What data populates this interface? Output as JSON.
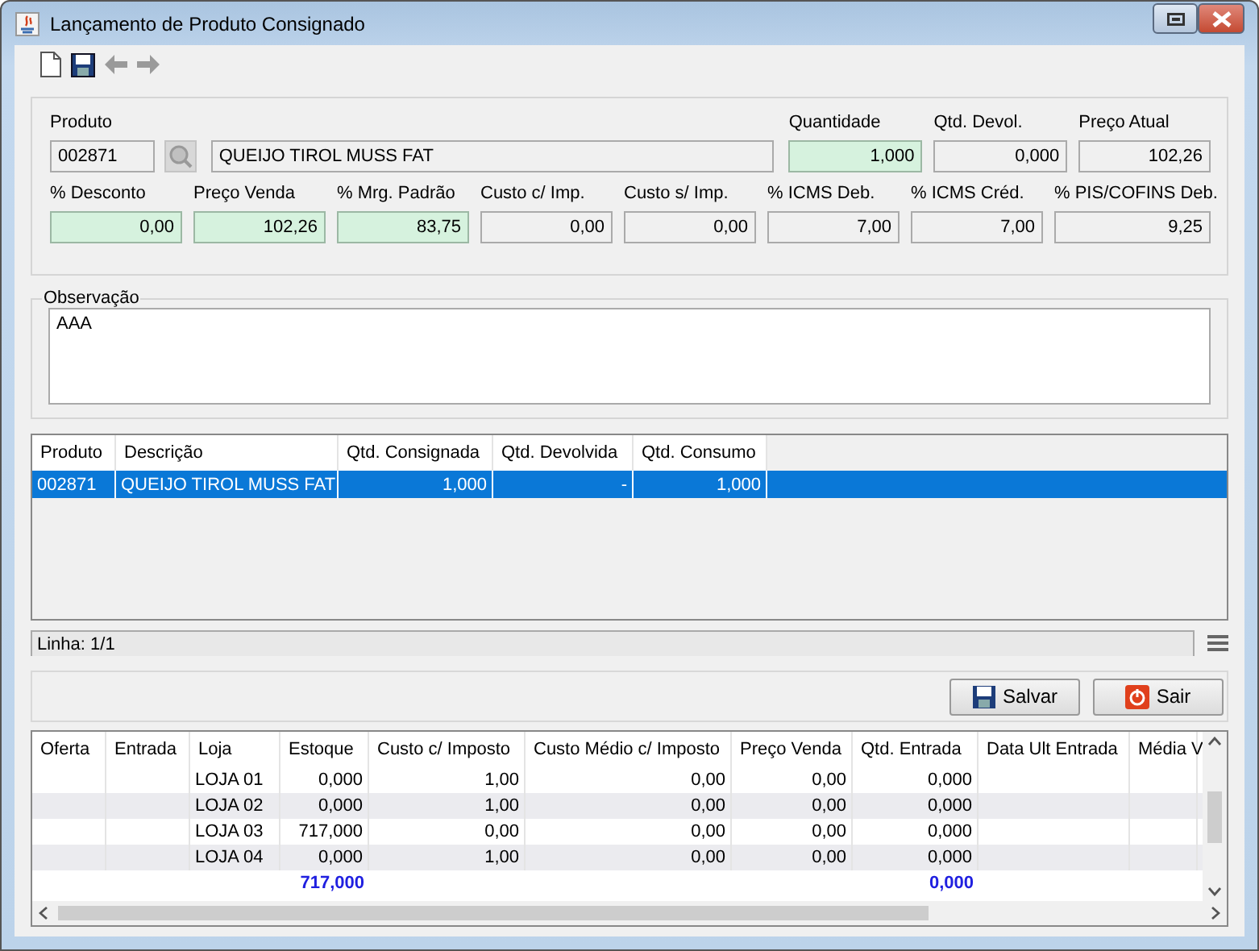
{
  "window": {
    "title": "Lançamento de Produto Consignado"
  },
  "product": {
    "label": "Produto",
    "code": "002871",
    "description": "QUEIJO TIROL MUSS FAT"
  },
  "top_fields": [
    {
      "label": "Quantidade",
      "value": "1,000",
      "editable": true
    },
    {
      "label": "Qtd. Devol.",
      "value": "0,000",
      "editable": false
    },
    {
      "label": "Preço Atual",
      "value": "102,26",
      "editable": false
    }
  ],
  "fields": [
    {
      "label": "% Desconto",
      "value": "0,00",
      "editable": true
    },
    {
      "label": "Preço Venda",
      "value": "102,26",
      "editable": true
    },
    {
      "label": "% Mrg. Padrão",
      "value": "83,75",
      "editable": true
    },
    {
      "label": "Custo c/ Imp.",
      "value": "0,00",
      "editable": false
    },
    {
      "label": "Custo s/ Imp.",
      "value": "0,00",
      "editable": false
    },
    {
      "label": "% ICMS Deb.",
      "value": "7,00",
      "editable": false
    },
    {
      "label": "% ICMS Créd.",
      "value": "7,00",
      "editable": false
    },
    {
      "label": "% PIS/COFINS Deb.",
      "value": "9,25",
      "editable": false
    }
  ],
  "observation": {
    "label": "Observação",
    "value": "AAA"
  },
  "items_table": {
    "columns": [
      "Produto",
      "Descrição",
      "Qtd. Consignada",
      "Qtd. Devolvida",
      "Qtd. Consumo"
    ],
    "rows": [
      {
        "cells": [
          "002871",
          "QUEIJO TIROL MUSS FAT",
          "1,000",
          "-",
          "1,000"
        ],
        "selected": true
      }
    ]
  },
  "status_bar": {
    "text": "Linha: 1/1"
  },
  "buttons": [
    {
      "label": "Salvar",
      "kind": "save"
    },
    {
      "label": "Sair",
      "kind": "exit"
    }
  ],
  "stock_table": {
    "columns": [
      "Oferta",
      "Entrada",
      "Loja",
      "Estoque",
      "Custo c/ Imposto",
      "Custo Médio c/ Imposto",
      "Preço Venda",
      "Qtd. Entrada",
      "Data Ult Entrada",
      "Média V"
    ],
    "rows": [
      {
        "cells": [
          null,
          null,
          "LOJA 01",
          "0,000",
          "1,00",
          "0,00",
          "0,00",
          "0,000",
          null,
          null
        ]
      },
      {
        "cells": [
          null,
          null,
          "LOJA 02",
          "0,000",
          "1,00",
          "0,00",
          "0,00",
          "0,000",
          null,
          null
        ]
      },
      {
        "cells": [
          null,
          null,
          "LOJA 03",
          "717,000",
          "0,00",
          "0,00",
          "0,00",
          "0,000",
          null,
          null
        ]
      },
      {
        "cells": [
          null,
          null,
          "LOJA 04",
          "0,000",
          "1,00",
          "0,00",
          "0,00",
          "0,000",
          null,
          null
        ]
      }
    ],
    "totals": {
      "stock": "717,000",
      "entry_qty": "0,000"
    }
  }
}
